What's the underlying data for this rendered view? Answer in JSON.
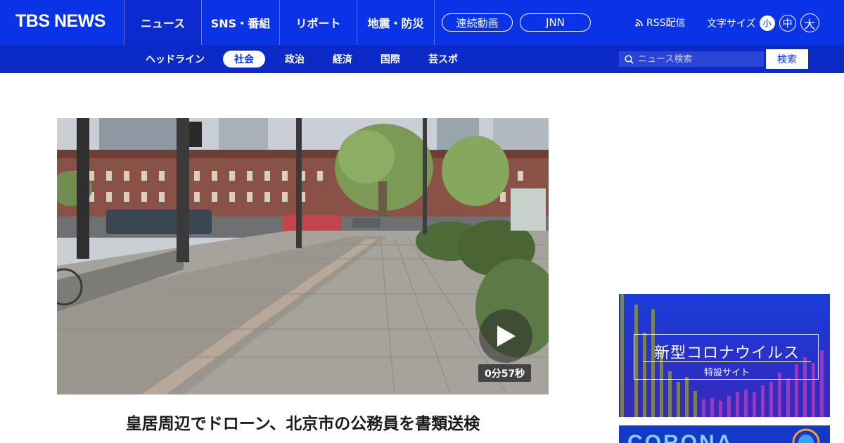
{
  "header": {
    "logo": "TBS NEWS",
    "nav": [
      {
        "label": "ニュース",
        "active": true
      },
      {
        "label": "SNS・番組"
      },
      {
        "label": "リポート"
      },
      {
        "label": "地震・防災"
      }
    ],
    "pills": [
      "連続動画",
      "JNN"
    ],
    "rss_label": "RSS配信",
    "font_size_label": "文字サイズ",
    "font_sizes": [
      "小",
      "中",
      "大"
    ]
  },
  "subnav": {
    "items": [
      "ヘッドライン",
      "社会",
      "政治",
      "経済",
      "国際",
      "芸スポ"
    ],
    "active": "社会"
  },
  "search": {
    "placeholder": "ニュース検索",
    "button_label": "検索"
  },
  "article": {
    "video_duration": "0分57秒",
    "headline": "皇居周辺でドローン、北京市の公務員を書類送検"
  },
  "sidebar": {
    "banner1_title": "新型コロナウイルス",
    "banner1_subtitle": "特設サイト",
    "banner2_text": "CORONA"
  },
  "colors": {
    "brand_blue": "#0a32e6",
    "subnav_blue": "#0b2ac8"
  }
}
